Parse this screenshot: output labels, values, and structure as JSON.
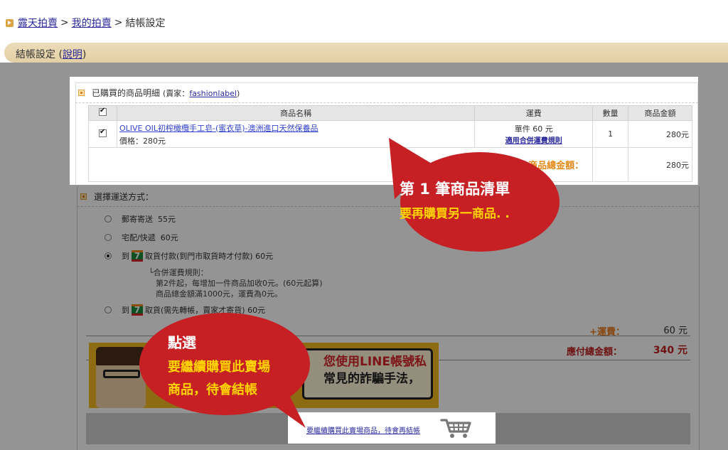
{
  "breadcrumb": {
    "home": "露天拍賣",
    "sep1": ">",
    "myauction": "我的拍賣",
    "sep2": ">",
    "current": "結帳設定"
  },
  "title": {
    "text": "結帳設定",
    "open_paren": "(",
    "help": "說明",
    "close_paren": ")"
  },
  "purchased": {
    "heading": "已購買的商品明細",
    "seller_prefix": "(賣家：",
    "seller": "fashionlabel",
    "seller_suffix": ")",
    "columns": {
      "select": "",
      "name": "商品名稱",
      "shipping": "運費",
      "qty": "數量",
      "amount": "商品金額"
    },
    "item": {
      "name": "OLIVE OIL初榨橄欖手工皂-(蜜衣草)-澳洲進口天然保養品",
      "price": "價格：280元",
      "shipping_unit": "單件 60 元",
      "shipping_rule_link": "適用合併運費規則",
      "qty": "1",
      "amount": "280元"
    },
    "total_label": "商品總金額：",
    "total_value": "280元"
  },
  "shipping": {
    "heading": "選擇運送方式：",
    "options": [
      {
        "label": "郵寄寄送",
        "fee": "55元"
      },
      {
        "label": "宅配/快遞",
        "fee": "60元"
      },
      {
        "prefix": "到",
        "label": "取貨付款(到門市取貨時才付款)",
        "fee": "60元"
      },
      {
        "prefix": "到",
        "label": "取貨(需先轉帳，賣家才寄貨)",
        "fee": "60元"
      }
    ],
    "rules": {
      "title": "└合併運費規則：",
      "line1": "第2件起，每增加一件商品加收0元。(60元起算)",
      "line2": "商品總金額滿1000元，運費為0元。"
    },
    "fee_label": "+運費：",
    "fee_value": "60 元",
    "due_label": "應付總金額：",
    "due_value": "340 元"
  },
  "banner": {
    "line1": "您使用LINE帳號私",
    "line2": "常見的詐騙手法，"
  },
  "continue": {
    "link": "要繼續購買此賣場商品，待會再結帳"
  },
  "callouts": {
    "first": {
      "heading": "第 1 筆商品清單",
      "sub": "要再購買另一商品. ."
    },
    "second": {
      "heading": "點選",
      "sub1": "要繼續購買此賣場",
      "sub2": "商品，待會結帳"
    }
  },
  "colors": {
    "callout": "#c62024",
    "callout_sub": "#ffd400",
    "link": "#2a2a9c",
    "accent_orange": "#e38a1a",
    "due_red": "#c02020"
  },
  "icons": {
    "cart": "cart-icon",
    "seven_eleven": "seven-eleven-logo-icon"
  }
}
